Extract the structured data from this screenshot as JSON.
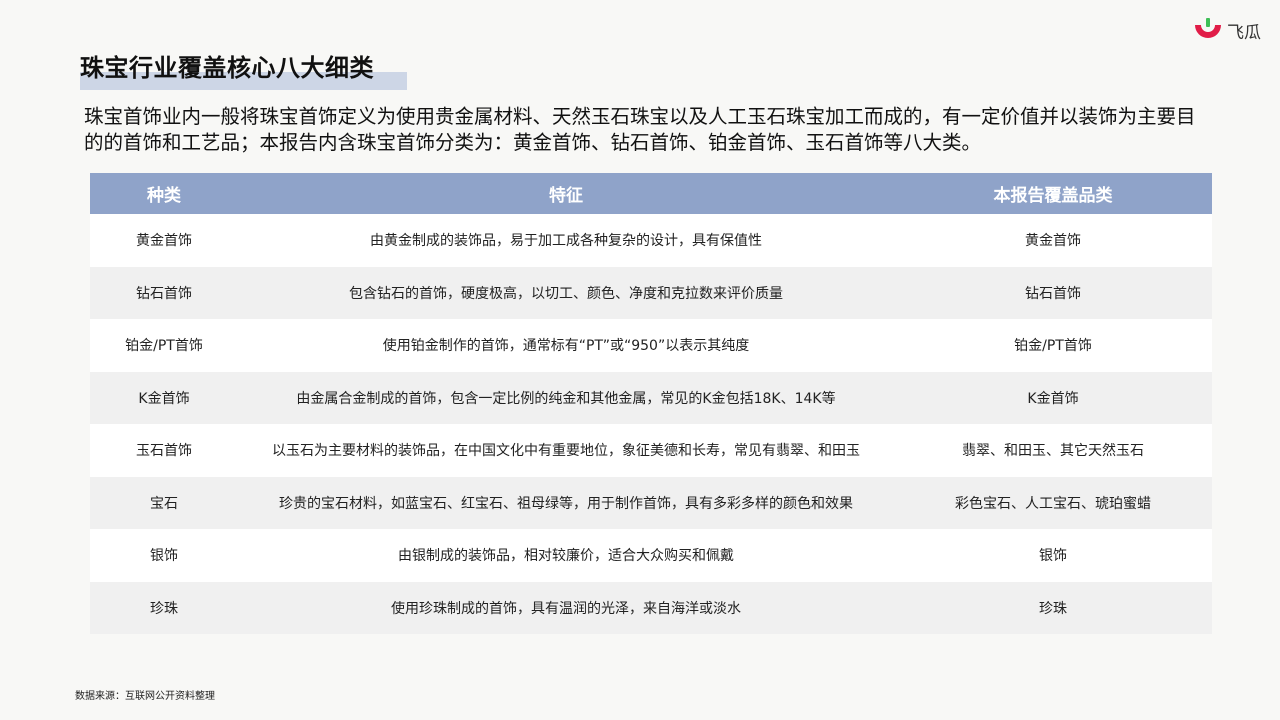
{
  "brand": {
    "logo_text": "飞瓜",
    "accent_red": "#e11d48",
    "accent_green": "#3fbf57"
  },
  "title": "珠宝行业覆盖核心八大细类",
  "intro": "珠宝首饰业内一般将珠宝首饰定义为使用贵金属材料、天然玉石珠宝以及人工玉石珠宝加工而成的，有一定价值并以装饰为主要目的的首饰和工艺品；本报告内含珠宝首饰分类为：黄金首饰、钻石首饰、铂金首饰、玉石首饰等八大类。",
  "table": {
    "header_color": "#8fa3c9",
    "columns": [
      "种类",
      "特征",
      "本报告覆盖品类"
    ],
    "rows": [
      {
        "type": "黄金首饰",
        "feature": "由黄金制成的装饰品，易于加工成各种复杂的设计，具有保值性",
        "covered": "黄金首饰"
      },
      {
        "type": "钻石首饰",
        "feature": "包含钻石的首饰，硬度极高，以切工、颜色、净度和克拉数来评价质量",
        "covered": "钻石首饰"
      },
      {
        "type": "铂金/PT首饰",
        "feature": "使用铂金制作的首饰，通常标有“PT”或“950”以表示其纯度",
        "covered": "铂金/PT首饰"
      },
      {
        "type": "K金首饰",
        "feature": "由金属合金制成的首饰，包含一定比例的纯金和其他金属，常见的K金包括18K、14K等",
        "covered": "K金首饰"
      },
      {
        "type": "玉石首饰",
        "feature": "以玉石为主要材料的装饰品，在中国文化中有重要地位，象征美德和长寿，常见有翡翠、和田玉",
        "covered": "翡翠、和田玉、其它天然玉石"
      },
      {
        "type": "宝石",
        "feature": "珍贵的宝石材料，如蓝宝石、红宝石、祖母绿等，用于制作首饰，具有多彩多样的颜色和效果",
        "covered": "彩色宝石、人工宝石、琥珀蜜蜡"
      },
      {
        "type": "银饰",
        "feature": "由银制成的装饰品，相对较廉价，适合大众购买和佩戴",
        "covered": "银饰"
      },
      {
        "type": "珍珠",
        "feature": "使用珍珠制成的首饰，具有温润的光泽，来自海洋或淡水",
        "covered": "珍珠"
      }
    ]
  },
  "source": "数据来源：互联网公开资料整理"
}
